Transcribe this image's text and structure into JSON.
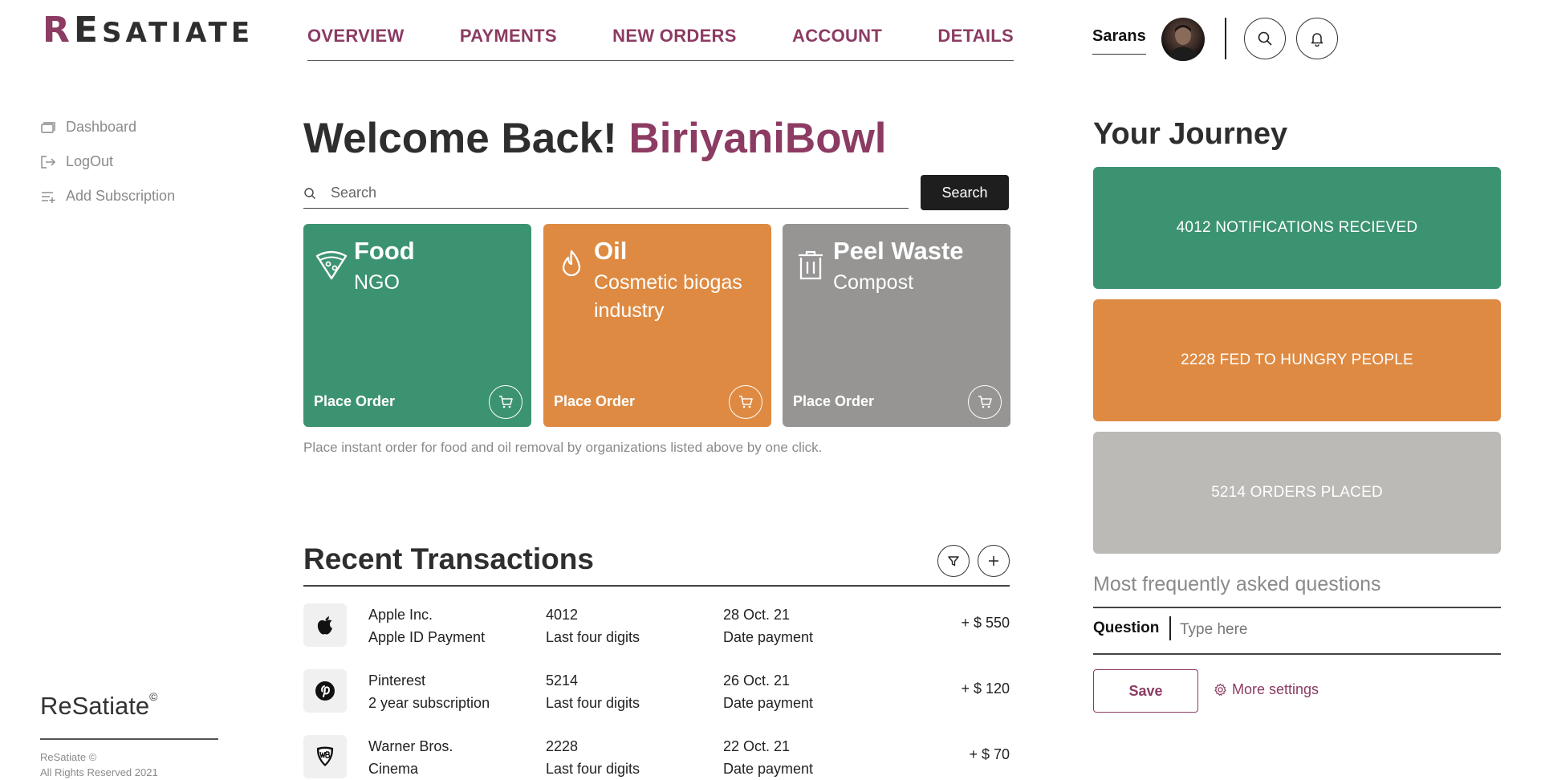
{
  "brand": {
    "logo_first": "R",
    "logo_second": "E",
    "logo_rest": "SATIATE",
    "footer_name": "ReSatiate",
    "footer_mark": "©",
    "footer_line1": "ReSatiate ©",
    "footer_line2": "All Rights Reserved 2021"
  },
  "nav": {
    "items": [
      {
        "label": "OVERVIEW"
      },
      {
        "label": "PAYMENTS"
      },
      {
        "label": "NEW ORDERS"
      },
      {
        "label": "ACCOUNT"
      },
      {
        "label": "DETAILS"
      }
    ]
  },
  "user": {
    "name": "Sarans"
  },
  "sidebar": {
    "items": [
      {
        "label": "Dashboard",
        "icon": "dashboard-icon"
      },
      {
        "label": "LogOut",
        "icon": "logout-icon"
      },
      {
        "label": "Add Subscription",
        "icon": "list-add-icon"
      }
    ]
  },
  "welcome": {
    "prefix": "Welcome Back! ",
    "name": "BiriyaniBowl"
  },
  "search": {
    "placeholder": "Search",
    "button_label": "Search"
  },
  "cards": [
    {
      "title": "Food",
      "subtitle": "NGO",
      "action": "Place Order",
      "color": "#3c9371",
      "icon": "pizza-icon"
    },
    {
      "title": "Oil",
      "subtitle": "Cosmetic biogas industry",
      "action": "Place Order",
      "color": "#de8a42",
      "icon": "flame-icon"
    },
    {
      "title": "Peel Waste",
      "subtitle": "Compost",
      "action": "Place Order",
      "color": "#969594",
      "icon": "trash-icon"
    }
  ],
  "cards_hint": "Place instant order for food and oil removal by organizations listed above by one click.",
  "transactions": {
    "title": "Recent Transactions",
    "rows": [
      {
        "name": "Apple Inc.",
        "desc": "Apple ID Payment",
        "digits": "4012",
        "digits_label": "Last four digits",
        "date": "28 Oct. 21",
        "date_label": "Date payment",
        "amount": "+ $ 550",
        "icon": "apple-icon"
      },
      {
        "name": "Pinterest",
        "desc": "2 year subscription",
        "digits": "5214",
        "digits_label": "Last four digits",
        "date": "26 Oct. 21",
        "date_label": "Date payment",
        "amount": "+ $ 120",
        "icon": "pinterest-icon"
      },
      {
        "name": "Warner Bros.",
        "desc": "Cinema",
        "digits": "2228",
        "digits_label": "Last four digits",
        "date": "22 Oct. 21",
        "date_label": "Date payment",
        "amount": "+ $ 70",
        "icon": "warner-bros-icon"
      }
    ]
  },
  "journey": {
    "title": "Your Journey",
    "stats": [
      {
        "label": "4012 NOTIFICATIONS RECIEVED",
        "color": "#3c9371"
      },
      {
        "label": "2228 FED TO HUNGRY PEOPLE",
        "color": "#de8a42"
      },
      {
        "label": "5214 ORDERS PLACED",
        "color": "#bbbab6"
      }
    ]
  },
  "faq": {
    "title": "Most frequently asked questions",
    "question_label": "Question",
    "placeholder": "Type here",
    "save_label": "Save",
    "more_settings_label": "More settings"
  }
}
